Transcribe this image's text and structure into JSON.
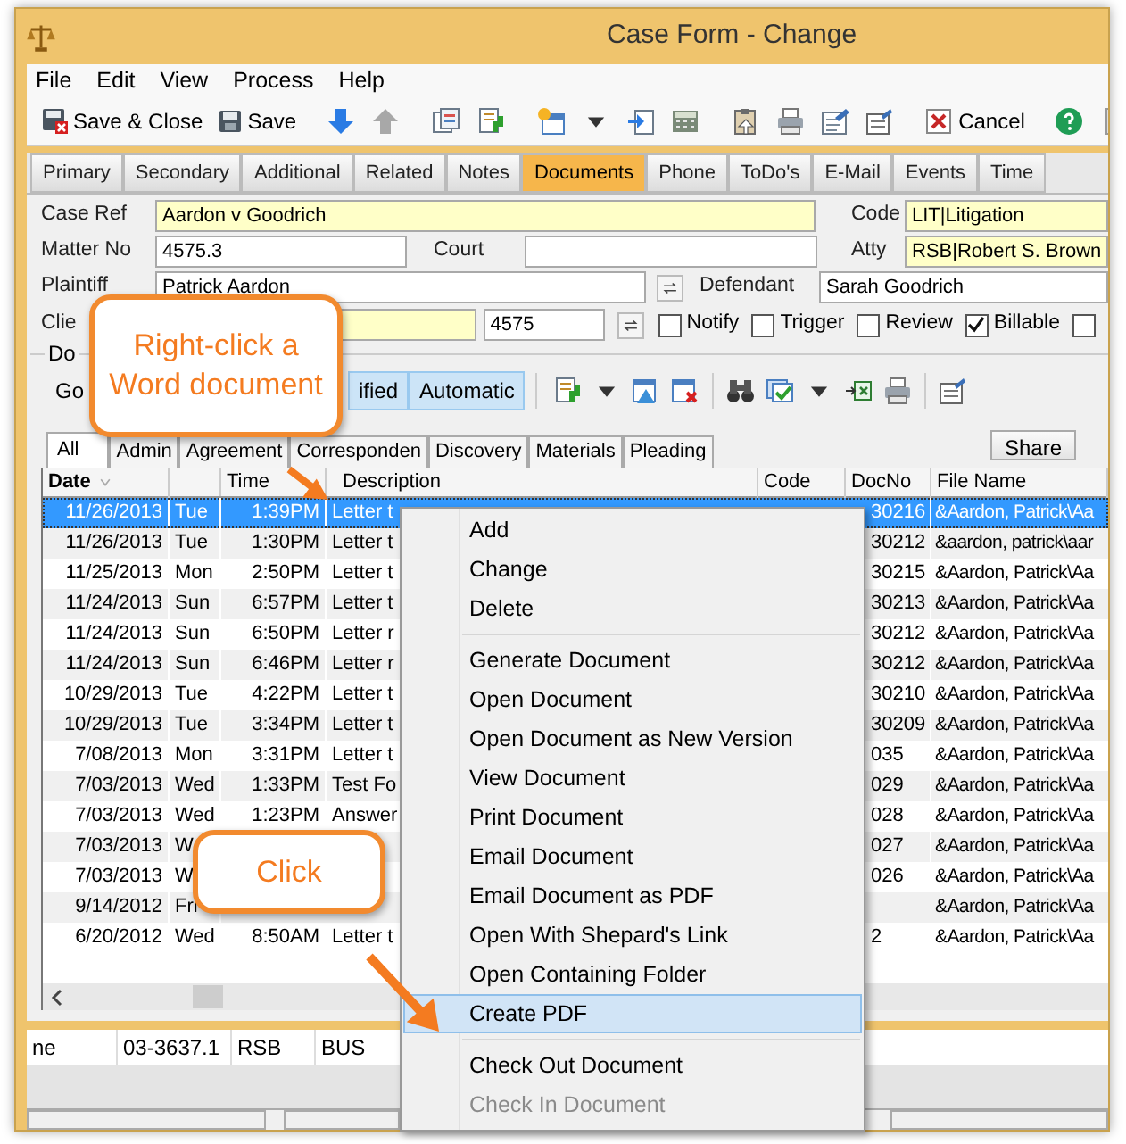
{
  "window": {
    "title": "Case Form - Change"
  },
  "menu": [
    "File",
    "Edit",
    "View",
    "Process",
    "Help"
  ],
  "toolbar": {
    "save_close": "Save & Close",
    "save": "Save",
    "cancel": "Cancel"
  },
  "tabs": [
    {
      "label": "Primary",
      "selected": false
    },
    {
      "label": "Secondary",
      "selected": false
    },
    {
      "label": "Additional",
      "selected": false
    },
    {
      "label": "Related",
      "selected": false
    },
    {
      "label": "Notes",
      "selected": false
    },
    {
      "label": "Documents",
      "selected": true
    },
    {
      "label": "Phone",
      "selected": false
    },
    {
      "label": "ToDo's",
      "selected": false
    },
    {
      "label": "E-Mail",
      "selected": false
    },
    {
      "label": "Events",
      "selected": false
    },
    {
      "label": "Time",
      "selected": false
    }
  ],
  "form": {
    "case_ref": {
      "label": "Case Ref",
      "value": "Aardon v Goodrich"
    },
    "code": {
      "label": "Code",
      "value": "LIT|Litigation"
    },
    "matter_no": {
      "label": "Matter No",
      "value": "4575.3"
    },
    "court": {
      "label": "Court"
    },
    "atty": {
      "label": "Atty",
      "value": "RSB|Robert S. Brown"
    },
    "plaintiff": {
      "label": "Plaintiff",
      "value": "Patrick Aardon"
    },
    "defendant": {
      "label": "Defendant",
      "value": "Sarah Goodrich"
    },
    "client": {
      "label": "Clie",
      "number": "4575"
    },
    "flags": [
      {
        "label": "Notify",
        "checked": false
      },
      {
        "label": "Trigger",
        "checked": false
      },
      {
        "label": "Review",
        "checked": false
      },
      {
        "label": "Billable",
        "checked": true
      },
      {
        "checked": false
      }
    ]
  },
  "documents": {
    "group_label": "Do",
    "buttons": [
      {
        "label": "Go",
        "selected": false
      },
      {
        "label": "ified",
        "selected": true
      },
      {
        "label": "Automatic",
        "selected": true
      }
    ],
    "subtabs": [
      {
        "label": "All",
        "selected": true
      },
      {
        "label": "Admin",
        "selected": false
      },
      {
        "label": "Agreement",
        "selected": false
      },
      {
        "label": "Corresponden",
        "selected": false
      },
      {
        "label": "Discovery",
        "selected": false
      },
      {
        "label": "Materials",
        "selected": false
      },
      {
        "label": "Pleading",
        "selected": false
      }
    ],
    "share": "Share",
    "columns": [
      "Date",
      "Time",
      "Description",
      "Code",
      "DocNo",
      "File Name"
    ],
    "rows": [
      {
        "date": "11/26/2013",
        "day": "Tue",
        "time": "1:39PM",
        "description": "Letter t",
        "docno": "30216",
        "file": "&Aardon, Patrick\\Aa",
        "selected": true
      },
      {
        "date": "11/26/2013",
        "day": "Tue",
        "time": "1:30PM",
        "description": "Letter t",
        "docno": "30212",
        "file": "&aardon, patrick\\aar",
        "selected": false
      },
      {
        "date": "11/25/2013",
        "day": "Mon",
        "time": "2:50PM",
        "description": "Letter t",
        "docno": "30215",
        "file": "&Aardon, Patrick\\Aa",
        "selected": false
      },
      {
        "date": "11/24/2013",
        "day": "Sun",
        "time": "6:57PM",
        "description": "Letter t",
        "docno": "30213",
        "file": "&Aardon, Patrick\\Aa",
        "selected": false
      },
      {
        "date": "11/24/2013",
        "day": "Sun",
        "time": "6:50PM",
        "description": "Letter r",
        "docno": "30212",
        "file": "&Aardon, Patrick\\Aa",
        "selected": false
      },
      {
        "date": "11/24/2013",
        "day": "Sun",
        "time": "6:46PM",
        "description": "Letter r",
        "docno": "30212",
        "file": "&Aardon, Patrick\\Aa",
        "selected": false
      },
      {
        "date": "10/29/2013",
        "day": "Tue",
        "time": "4:22PM",
        "description": "Letter t",
        "docno": "30210",
        "file": "&Aardon, Patrick\\Aa",
        "selected": false
      },
      {
        "date": "10/29/2013",
        "day": "Tue",
        "time": "3:34PM",
        "description": "Letter t",
        "docno": "30209",
        "file": "&Aardon, Patrick\\Aa",
        "selected": false
      },
      {
        "date": "7/08/2013",
        "day": "Mon",
        "time": "3:31PM",
        "description": "Letter t",
        "docno": "035",
        "file": "&Aardon, Patrick\\Aa",
        "selected": false
      },
      {
        "date": "7/03/2013",
        "day": "Wed",
        "time": "1:33PM",
        "description": "Test Fo",
        "docno": "029",
        "file": "&Aardon, Patrick\\Aa",
        "selected": false
      },
      {
        "date": "7/03/2013",
        "day": "Wed",
        "time": "1:23PM",
        "description": "Answer",
        "docno": "028",
        "file": "&Aardon, Patrick\\Aa",
        "selected": false
      },
      {
        "date": "7/03/2013",
        "day": "W",
        "docno": "027",
        "file": "&Aardon, Patrick\\Aa",
        "selected": false
      },
      {
        "date": "7/03/2013",
        "day": "W",
        "docno": "026",
        "file": "&Aardon, Patrick\\Aa",
        "selected": false
      },
      {
        "date": "9/14/2012",
        "day": "Fri",
        "file": "&Aardon, Patrick\\Aa",
        "selected": false
      },
      {
        "date": "6/20/2012",
        "day": "Wed",
        "time": "8:50AM",
        "description": "Letter t",
        "docno": "2",
        "file": "&Aardon, Patrick\\Aa",
        "selected": false
      }
    ]
  },
  "lower_row": [
    "ne",
    "03-3637.1",
    "RSB",
    "BUS"
  ],
  "context_menu": [
    {
      "kind": "item",
      "label": "Add",
      "selected": false,
      "disabled": false
    },
    {
      "kind": "item",
      "label": "Change",
      "selected": false,
      "disabled": false
    },
    {
      "kind": "item",
      "label": "Delete",
      "selected": false,
      "disabled": false
    },
    {
      "kind": "separator"
    },
    {
      "kind": "item",
      "label": "Generate Document",
      "selected": false,
      "disabled": false
    },
    {
      "kind": "item",
      "label": "Open Document",
      "selected": false,
      "disabled": false
    },
    {
      "kind": "item",
      "label": "Open Document as New Version",
      "selected": false,
      "disabled": false
    },
    {
      "kind": "item",
      "label": "View Document",
      "selected": false,
      "disabled": false
    },
    {
      "kind": "item",
      "label": "Print Document",
      "selected": false,
      "disabled": false
    },
    {
      "kind": "item",
      "label": "Email Document",
      "selected": false,
      "disabled": false
    },
    {
      "kind": "item",
      "label": "Email Document as PDF",
      "selected": false,
      "disabled": false
    },
    {
      "kind": "item",
      "label": "Open With Shepard's Link",
      "selected": false,
      "disabled": false
    },
    {
      "kind": "item",
      "label": "Open Containing Folder",
      "selected": false,
      "disabled": false
    },
    {
      "kind": "item",
      "label": "Create PDF",
      "selected": true,
      "disabled": false
    },
    {
      "kind": "separator"
    },
    {
      "kind": "item",
      "label": "Check Out Document",
      "selected": false,
      "disabled": false
    },
    {
      "kind": "item",
      "label": "Check In Document",
      "selected": false,
      "disabled": true
    }
  ],
  "callouts": [
    {
      "text": "Right-click a Word document"
    },
    {
      "text": "Click"
    }
  ]
}
